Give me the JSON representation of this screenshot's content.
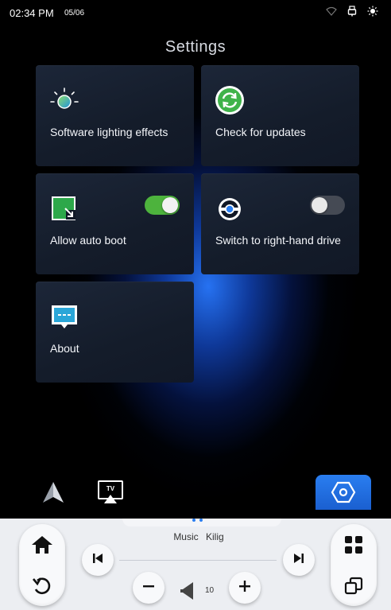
{
  "status": {
    "time": "02:34 PM",
    "date": "05/06",
    "icons": [
      "wifi-icon",
      "usb-icon",
      "brightness-icon"
    ]
  },
  "page": {
    "title": "Settings"
  },
  "tiles": [
    {
      "label": "Software lighting effects",
      "icon": "lighting-effects-icon"
    },
    {
      "label": "Check for updates",
      "icon": "update-icon"
    },
    {
      "label": "Allow auto boot",
      "icon": "auto-boot-icon",
      "toggle": true
    },
    {
      "label": "Switch to right-hand drive",
      "icon": "steering-wheel-icon",
      "toggle": false
    },
    {
      "label": "About",
      "icon": "about-message-icon"
    }
  ],
  "dock": {
    "items": [
      "android-auto-icon",
      "tv-cast-icon"
    ],
    "active": "settings-hexagon-icon"
  },
  "media_panel": {
    "source": "Music",
    "track": "Kilig",
    "volume": "10"
  },
  "colors": {
    "accent": "#2a7ef0",
    "toggle_on": "#4db33d",
    "toggle_off": "#454a54",
    "tile_bg": "#161e2c"
  }
}
